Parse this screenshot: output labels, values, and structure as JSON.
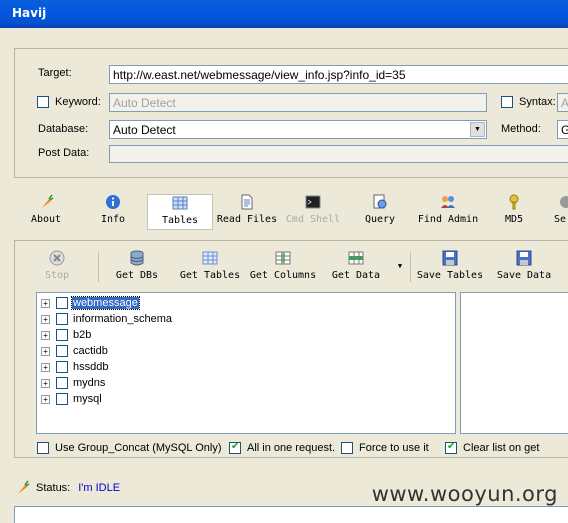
{
  "window": {
    "title": "Havij"
  },
  "target_form": {
    "target_label": "Target:",
    "target_value": "http://w.east.net/webmessage/view_info.jsp?info_id=35",
    "keyword_label": "Keyword:",
    "keyword_placeholder": "Auto Detect",
    "syntax_label": "Syntax:",
    "syntax_value": "A",
    "database_label": "Database:",
    "database_value": "Auto Detect",
    "method_label": "Method:",
    "method_value": "G",
    "postdata_label": "Post Data:"
  },
  "tabs": [
    {
      "label": "About",
      "icon": "carrot-icon"
    },
    {
      "label": "Info",
      "icon": "info-icon"
    },
    {
      "label": "Tables",
      "icon": "table-icon",
      "active": true
    },
    {
      "label": "Read Files",
      "icon": "document-icon"
    },
    {
      "label": "Cmd Shell",
      "icon": "terminal-icon",
      "disabled": true
    },
    {
      "label": "Query",
      "icon": "query-icon"
    },
    {
      "label": "Find Admin",
      "icon": "admin-icon"
    },
    {
      "label": "MD5",
      "icon": "key-icon"
    },
    {
      "label": "Se",
      "icon": "settings-icon"
    }
  ],
  "toolbar": {
    "stop": "Stop",
    "get_dbs": "Get DBs",
    "get_tables": "Get Tables",
    "get_columns": "Get Columns",
    "get_data": "Get Data",
    "save_tables": "Save Tables",
    "save_data": "Save Data"
  },
  "tree_items": [
    "webmessage",
    "information_schema",
    "b2b",
    "cactidb",
    "hssddb",
    "mydns",
    "mysql"
  ],
  "options": {
    "group_concat": "Use Group_Concat (MySQL Only)",
    "all_in_one": "All in one request.",
    "force": "Force to use it",
    "clear_list": "Clear list on get"
  },
  "status": {
    "label": "Status:",
    "value": "I'm IDLE"
  },
  "watermark": "www.wooyun.org",
  "colors": {
    "titlebar": "#0358e0",
    "status_value": "#0000cc",
    "selection": "#316ac5"
  }
}
